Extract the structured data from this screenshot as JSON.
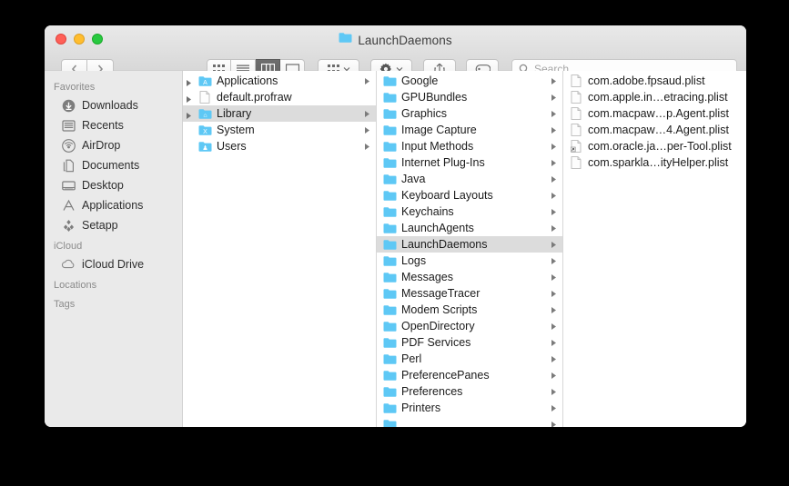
{
  "window": {
    "title": "LaunchDaemons",
    "title_icon": "folder-icon",
    "traffic_lights": [
      {
        "name": "close-button",
        "color": "#ff5f57"
      },
      {
        "name": "minimize-button",
        "color": "#ffbd2e"
      },
      {
        "name": "maximize-button",
        "color": "#28c940"
      }
    ]
  },
  "toolbar": {
    "back_label": "",
    "forward_label": "",
    "view_buttons": [
      {
        "name": "icon-view-button",
        "icon": "grid-icon",
        "active": false
      },
      {
        "name": "list-view-button",
        "icon": "list-icon",
        "active": false
      },
      {
        "name": "column-view-button",
        "icon": "columns-icon",
        "active": true
      },
      {
        "name": "gallery-view-button",
        "icon": "gallery-icon",
        "active": false
      }
    ],
    "arrange_label": "",
    "action_label": "",
    "share_label": "",
    "tags_label": ""
  },
  "search": {
    "placeholder": "Search",
    "value": ""
  },
  "sidebar": {
    "sections": [
      {
        "header": "Favorites",
        "items": [
          {
            "label": "Downloads",
            "icon": "downloads-icon"
          },
          {
            "label": "Recents",
            "icon": "recents-icon"
          },
          {
            "label": "AirDrop",
            "icon": "airdrop-icon"
          },
          {
            "label": "Documents",
            "icon": "documents-icon"
          },
          {
            "label": "Desktop",
            "icon": "desktop-icon"
          },
          {
            "label": "Applications",
            "icon": "applications-icon"
          },
          {
            "label": "Setapp",
            "icon": "setapp-icon"
          }
        ]
      },
      {
        "header": "iCloud",
        "items": [
          {
            "label": "iCloud Drive",
            "icon": "icloud-icon"
          }
        ]
      },
      {
        "header": "Locations",
        "items": []
      },
      {
        "header": "Tags",
        "items": []
      }
    ]
  },
  "columns": [
    {
      "name": "column-root",
      "rows": [
        {
          "label": "Applications",
          "icon": "applications-folder-icon",
          "selected": false,
          "has_arrow": true,
          "disclosure": true
        },
        {
          "label": "default.profraw",
          "icon": "document-icon",
          "selected": false,
          "has_arrow": false,
          "disclosure": true
        },
        {
          "label": "Library",
          "icon": "library-folder-icon",
          "selected": true,
          "has_arrow": true,
          "disclosure": true
        },
        {
          "label": "System",
          "icon": "system-folder-icon",
          "selected": false,
          "has_arrow": true,
          "disclosure": false
        },
        {
          "label": "Users",
          "icon": "users-folder-icon",
          "selected": false,
          "has_arrow": true,
          "disclosure": false
        }
      ]
    },
    {
      "name": "column-library",
      "rows": [
        {
          "label": "Google",
          "icon": "folder-icon",
          "selected": false,
          "has_arrow": true
        },
        {
          "label": "GPUBundles",
          "icon": "folder-icon",
          "selected": false,
          "has_arrow": true
        },
        {
          "label": "Graphics",
          "icon": "folder-icon",
          "selected": false,
          "has_arrow": true
        },
        {
          "label": "Image Capture",
          "icon": "folder-icon",
          "selected": false,
          "has_arrow": true
        },
        {
          "label": "Input Methods",
          "icon": "folder-icon",
          "selected": false,
          "has_arrow": true
        },
        {
          "label": "Internet Plug-Ins",
          "icon": "folder-icon",
          "selected": false,
          "has_arrow": true
        },
        {
          "label": "Java",
          "icon": "folder-icon",
          "selected": false,
          "has_arrow": true
        },
        {
          "label": "Keyboard Layouts",
          "icon": "folder-icon",
          "selected": false,
          "has_arrow": true
        },
        {
          "label": "Keychains",
          "icon": "folder-icon",
          "selected": false,
          "has_arrow": true
        },
        {
          "label": "LaunchAgents",
          "icon": "folder-icon",
          "selected": false,
          "has_arrow": true
        },
        {
          "label": "LaunchDaemons",
          "icon": "folder-icon",
          "selected": true,
          "has_arrow": true
        },
        {
          "label": "Logs",
          "icon": "folder-icon",
          "selected": false,
          "has_arrow": true
        },
        {
          "label": "Messages",
          "icon": "folder-icon",
          "selected": false,
          "has_arrow": true
        },
        {
          "label": "MessageTracer",
          "icon": "folder-icon",
          "selected": false,
          "has_arrow": true
        },
        {
          "label": "Modem Scripts",
          "icon": "folder-icon",
          "selected": false,
          "has_arrow": true
        },
        {
          "label": "OpenDirectory",
          "icon": "folder-icon",
          "selected": false,
          "has_arrow": true
        },
        {
          "label": "PDF Services",
          "icon": "folder-icon",
          "selected": false,
          "has_arrow": true
        },
        {
          "label": "Perl",
          "icon": "folder-icon",
          "selected": false,
          "has_arrow": true
        },
        {
          "label": "PreferencePanes",
          "icon": "folder-icon",
          "selected": false,
          "has_arrow": true
        },
        {
          "label": "Preferences",
          "icon": "folder-icon",
          "selected": false,
          "has_arrow": true
        },
        {
          "label": "Printers",
          "icon": "folder-icon",
          "selected": false,
          "has_arrow": true
        },
        {
          "label": "",
          "icon": "folder-icon",
          "selected": false,
          "has_arrow": true
        }
      ]
    },
    {
      "name": "column-launchdaemons",
      "rows": [
        {
          "label": "com.adobe.fpsaud.plist",
          "icon": "plist-document-icon",
          "selected": false,
          "has_arrow": false
        },
        {
          "label": "com.apple.in…etracing.plist",
          "icon": "plist-document-icon",
          "selected": false,
          "has_arrow": false
        },
        {
          "label": "com.macpaw…p.Agent.plist",
          "icon": "plist-document-icon",
          "selected": false,
          "has_arrow": false
        },
        {
          "label": "com.macpaw…4.Agent.plist",
          "icon": "plist-document-icon",
          "selected": false,
          "has_arrow": false
        },
        {
          "label": "com.oracle.ja…per-Tool.plist",
          "icon": "plist-alias-document-icon",
          "selected": false,
          "has_arrow": false
        },
        {
          "label": "com.sparkla…ityHelper.plist",
          "icon": "plist-document-icon",
          "selected": false,
          "has_arrow": false
        }
      ]
    }
  ],
  "colors": {
    "folder": "#5ec8f5",
    "selection": "#dcdcdc",
    "sidebar_bg": "#eaeaea",
    "titlebar_top": "#e9e9e9",
    "titlebar_bottom": "#d8d8d8"
  }
}
